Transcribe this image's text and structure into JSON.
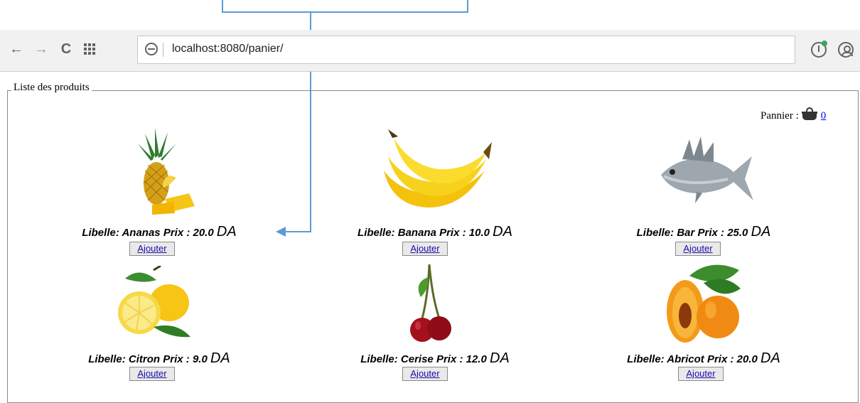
{
  "browser": {
    "url": "localhost:8080/panier/"
  },
  "fieldset": {
    "legend": "Liste des produits"
  },
  "cart": {
    "label": "Pannier :",
    "count": "0"
  },
  "labels": {
    "libelle": "Libelle:",
    "prix": "Prix :",
    "currency": "DA",
    "add_button": "Ajouter"
  },
  "products": [
    {
      "name": "Ananas",
      "price": "20.0",
      "icon": "pineapple-icon"
    },
    {
      "name": "Banana",
      "price": "10.0",
      "icon": "banana-icon"
    },
    {
      "name": "Bar",
      "price": "25.0",
      "icon": "fish-icon"
    },
    {
      "name": "Citron",
      "price": "9.0",
      "icon": "lemon-icon"
    },
    {
      "name": "Cerise",
      "price": "12.0",
      "icon": "cherry-icon"
    },
    {
      "name": "Abricot",
      "price": "20.0",
      "icon": "apricot-icon"
    }
  ],
  "colors": {
    "annotation": "#5b9bd5",
    "link": "#1a0dab"
  }
}
